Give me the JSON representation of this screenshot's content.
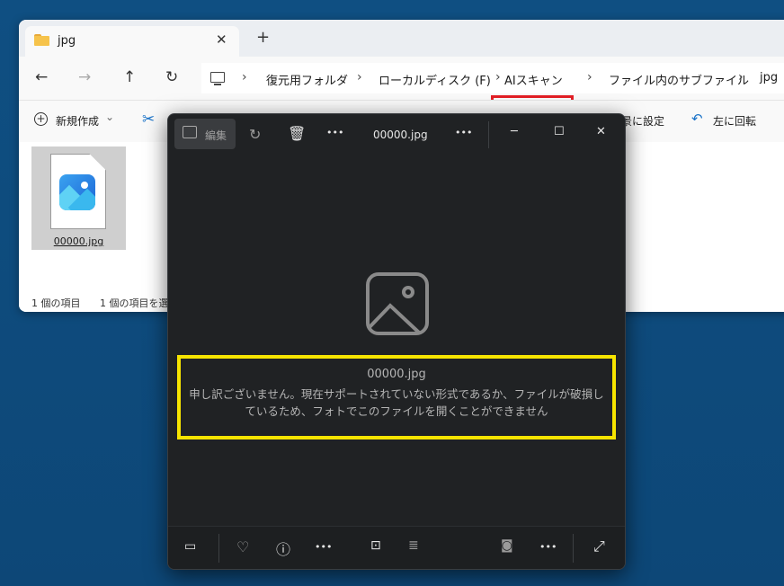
{
  "explorer": {
    "tab_title": "jpg",
    "tab_close": "✕",
    "tab_new": "+",
    "nav": {
      "back": "←",
      "forward": "→",
      "up": "↑",
      "refresh": "↻"
    },
    "breadcrumbs": [
      "復元用フォルダ",
      "ローカルディスク (F)",
      "AIスキャン",
      "ファイル内のサブファイル",
      "jpg"
    ],
    "crumb_sep": "›",
    "cmd": {
      "new_label": "新規作成",
      "new_arrow": "⌄",
      "set_bg": "景に設定",
      "rotate_left": "左に回転"
    },
    "file": {
      "name": "00000.jpg"
    },
    "status": {
      "count": "1 個の項目",
      "selected": "1 個の項目を選"
    }
  },
  "viewer": {
    "edit_label": "編集",
    "title": "00000.jpg",
    "more": "•••",
    "window": {
      "minimize": "─",
      "maximize": "☐",
      "close": "✕"
    },
    "message_file": "00000.jpg",
    "message": "申し訳ございません。現在サポートされていない形式であるか、ファイルが破損しているため、フォトでこのファイルを開くことができません"
  },
  "highlight_colors": {
    "red": "#e21f26",
    "yellow": "#f6e400"
  }
}
